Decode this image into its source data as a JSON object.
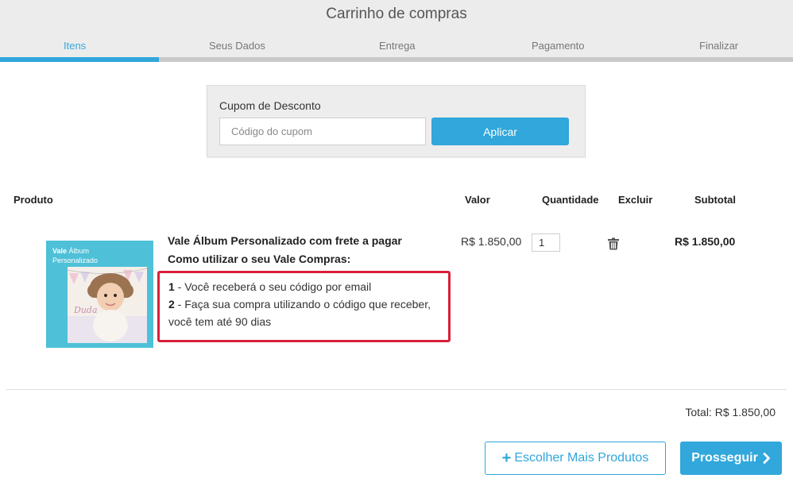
{
  "header": {
    "title": "Carrinho de compras",
    "steps": [
      {
        "label": "Itens",
        "active": true
      },
      {
        "label": "Seus Dados",
        "active": false
      },
      {
        "label": "Entrega",
        "active": false
      },
      {
        "label": "Pagamento",
        "active": false
      },
      {
        "label": "Finalizar",
        "active": false
      }
    ],
    "progress_fraction": 0.2
  },
  "coupon": {
    "label": "Cupom de Desconto",
    "placeholder": "Código do cupom",
    "value": "",
    "apply_label": "Aplicar"
  },
  "table": {
    "headers": {
      "product": "Produto",
      "price": "Valor",
      "quantity": "Quantidade",
      "remove": "Excluir",
      "subtotal": "Subtotal"
    },
    "item": {
      "image": {
        "brand": "Vale",
        "title_1": "Álbum",
        "title_2": "Personalizado",
        "photo_text": "Duda"
      },
      "name": "Vale Álbum Personalizado com frete a pagar",
      "howto_title": "Como utilizar o seu Vale Compras:",
      "instructions": [
        {
          "num": "1",
          "text": " - Você receberá o seu código por email"
        },
        {
          "num": "2",
          "text": " - Faça sua compra utilizando o código que receber,"
        }
      ],
      "instructions_tail": "você tem até 90 dias",
      "price": "R$ 1.850,00",
      "quantity": "1",
      "remove_icon": "trash-icon",
      "subtotal": "R$ 1.850,00"
    }
  },
  "total": "Total: R$ 1.850,00",
  "actions": {
    "more_products": "Escolher Mais Produtos",
    "more_icon": "plus-icon",
    "continue": "Prosseguir",
    "continue_icon": "chevron-right-icon"
  },
  "colors": {
    "accent": "#31a7db",
    "highlight_border": "#d8203b",
    "header_bg": "#ececec"
  }
}
